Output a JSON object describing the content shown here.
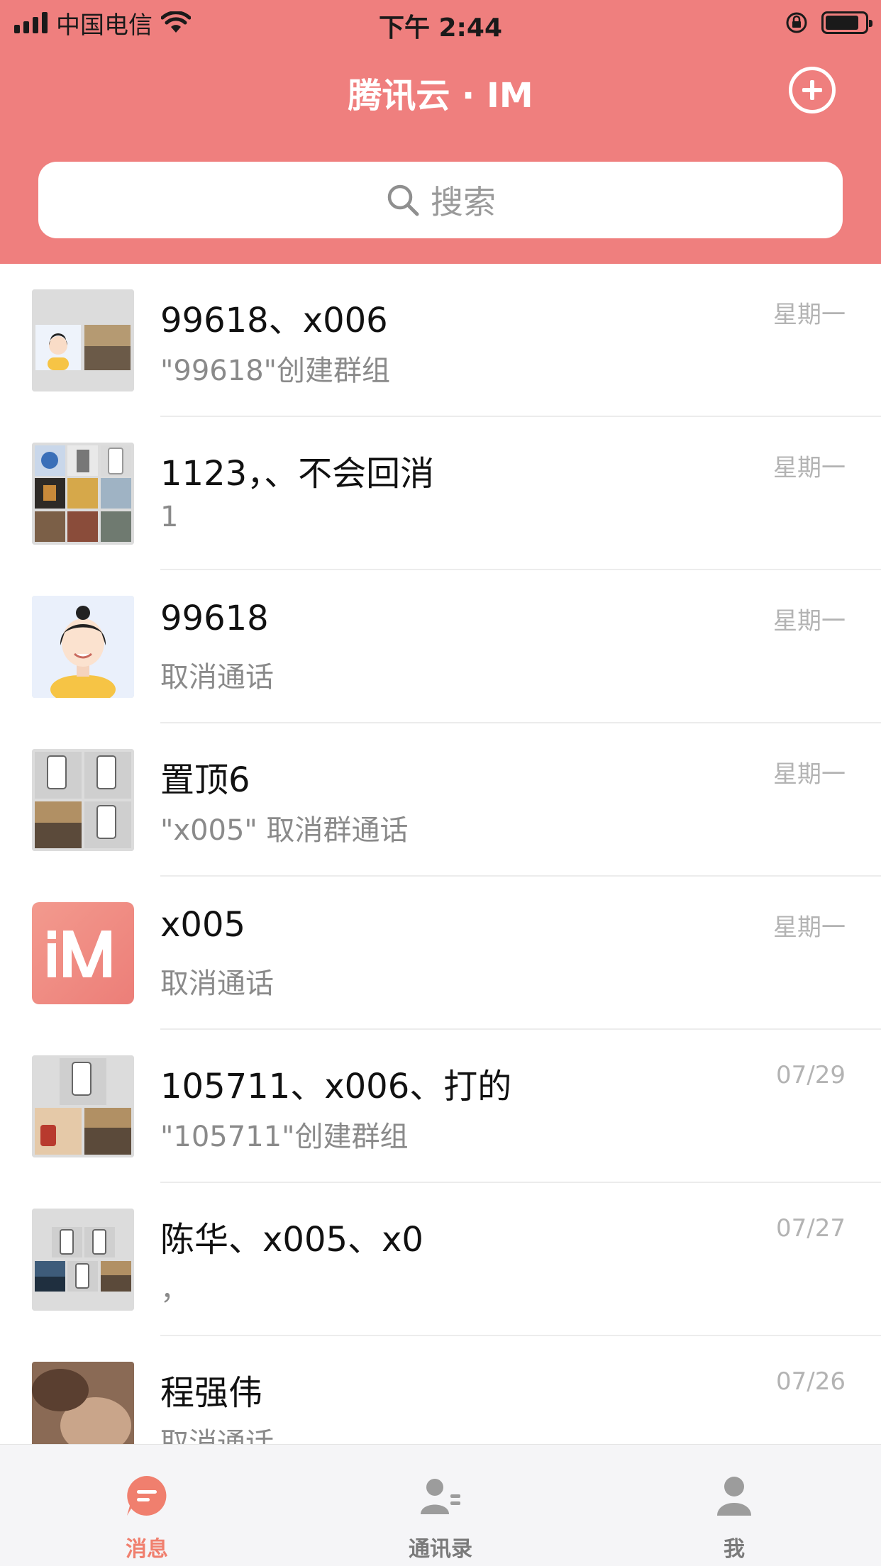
{
  "status_bar": {
    "carrier": "中国电信",
    "time": "下午 2:44"
  },
  "header": {
    "title": "腾讯云 · IM"
  },
  "search": {
    "placeholder": "搜索"
  },
  "conversations": [
    {
      "name": "99618、x006",
      "preview": "\"99618\"创建群组",
      "time": "星期一"
    },
    {
      "name": "1123，、不会回消",
      "preview": "1",
      "time": "星期一"
    },
    {
      "name": "99618",
      "preview": "取消通话",
      "time": "星期一"
    },
    {
      "name": "置顶6",
      "preview": "\"x005\" 取消群通话",
      "time": "星期一"
    },
    {
      "name": "x005",
      "preview": "取消通话",
      "time": "星期一"
    },
    {
      "name": "105711、x006、打的",
      "preview": "\"105711\"创建群组",
      "time": "07/29"
    },
    {
      "name": "陈华、x005、x0",
      "preview": "，",
      "time": "07/27"
    },
    {
      "name": "程强伟",
      "preview": "取消通话",
      "time": "07/26"
    }
  ],
  "tabs": [
    {
      "label": "消息",
      "icon": "message-icon",
      "active": true
    },
    {
      "label": "通讯录",
      "icon": "contacts-icon",
      "active": false
    },
    {
      "label": "我",
      "icon": "profile-icon",
      "active": false
    }
  ],
  "colors": {
    "header": "#ef7f7e",
    "tab_active": "#f07f6e",
    "tab_inactive": "#9c9c9c",
    "im_logo": "#ee7f78"
  }
}
